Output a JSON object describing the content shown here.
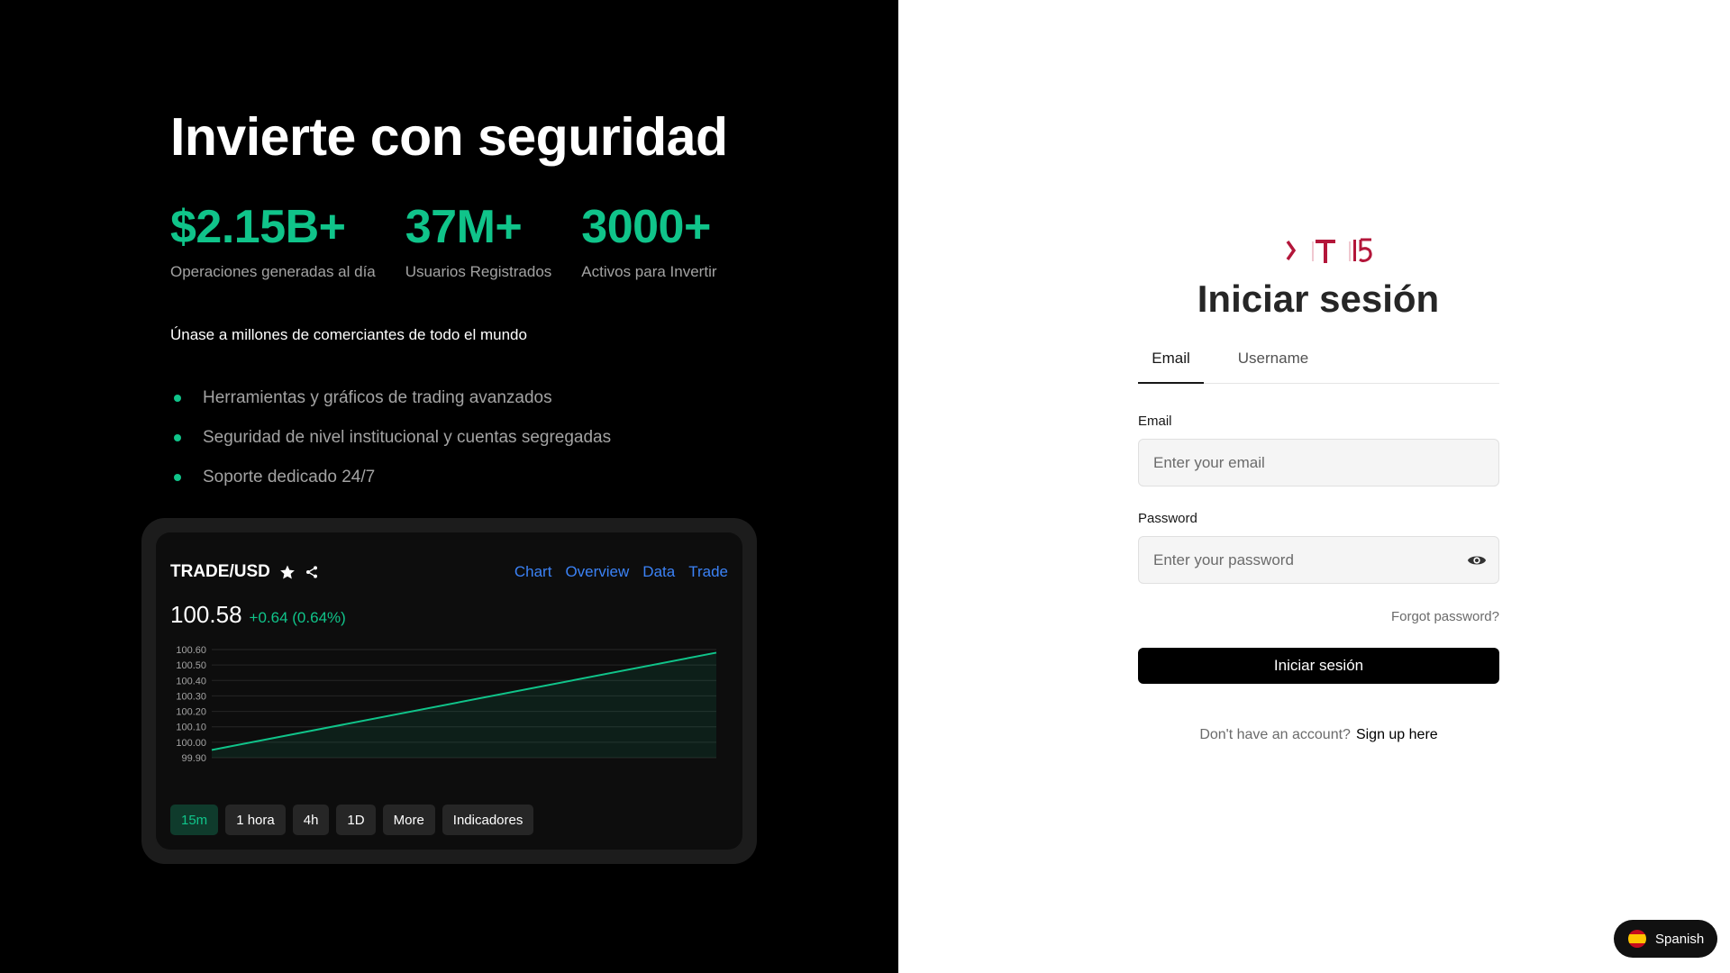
{
  "hero": {
    "title": "Invierte con seguridad",
    "stats": [
      {
        "value": "$2.15B+",
        "label": "Operaciones generadas al día"
      },
      {
        "value": "37M+",
        "label": "Usuarios Registrados"
      },
      {
        "value": "3000+",
        "label": "Activos para Invertir"
      }
    ],
    "join_text": "Únase a millones de comerciantes de todo el mundo",
    "features": [
      "Herramientas y gráficos de trading avanzados",
      "Seguridad de nivel institucional y cuentas segregadas",
      "Soporte dedicado 24/7"
    ]
  },
  "widget": {
    "pair": "TRADE/USD",
    "tabs": [
      "Chart",
      "Overview",
      "Data",
      "Trade"
    ],
    "price": "100.58",
    "change": "+0.64 (0.64%)",
    "timeframes": [
      "15m",
      "1 hora",
      "4h",
      "1D",
      "More",
      "Indicadores"
    ],
    "active_timeframe": "15m",
    "accent_color": "#10c48a",
    "link_color": "#3b82f6"
  },
  "chart_data": {
    "type": "area",
    "x": [
      0,
      1
    ],
    "series": [
      {
        "values": [
          99.95,
          100.58
        ]
      }
    ],
    "ylim": [
      99.9,
      100.6
    ],
    "yticks": [
      "100.60",
      "100.50",
      "100.40",
      "100.30",
      "100.20",
      "100.10",
      "100.00",
      "99.90"
    ],
    "grid": true
  },
  "login": {
    "title": "Iniciar sesión",
    "tabs": [
      "Email",
      "Username"
    ],
    "active_tab": "Email",
    "email_label": "Email",
    "email_placeholder": "Enter your email",
    "password_label": "Password",
    "password_placeholder": "Enter your password",
    "forgot": "Forgot password?",
    "submit": "Iniciar sesión",
    "no_account": "Don't have an account?",
    "signup": "Sign up here"
  },
  "language": {
    "label": "Spanish"
  }
}
